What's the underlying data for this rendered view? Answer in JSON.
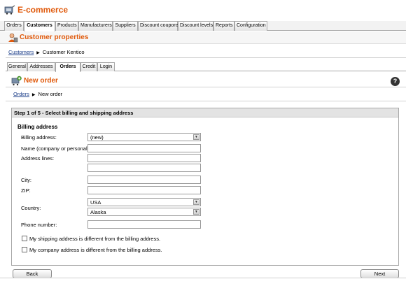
{
  "app": {
    "title": "E-commerce",
    "icon": "ecommerce-icon"
  },
  "main_tabs": [
    "Orders",
    "Customers",
    "Products",
    "Manufacturers",
    "Suppliers",
    "Discount coupons",
    "Discount levels",
    "Reports",
    "Configuration"
  ],
  "main_tab_active": "Customers",
  "section": {
    "title": "Customer properties",
    "icon": "customer-icon"
  },
  "breadcrumb1": {
    "link": "Customers",
    "current": "Customer Kentico"
  },
  "sub_tabs": [
    "General",
    "Addresses",
    "Orders",
    "Credit",
    "Login"
  ],
  "sub_tab_active": "Orders",
  "new_order": {
    "title": "New order",
    "icon": "new-order-icon"
  },
  "help": {
    "label": "?",
    "icon": "help-icon"
  },
  "breadcrumb2": {
    "link": "Orders",
    "current": "New order"
  },
  "wizard": {
    "step_title": "Step 1 of 5 - Select billing and shipping address",
    "section_title": "Billing address",
    "fields": {
      "billing_address_label": "Billing address:",
      "billing_address_value": "(new)",
      "name_label": "Name (company or personal):",
      "name_value": "",
      "address_lines_label": "Address lines:",
      "address_line1_value": "",
      "address_line2_value": "",
      "city_label": "City:",
      "city_value": "",
      "zip_label": "ZIP:",
      "zip_value": "",
      "country_label": "Country:",
      "country_value": "USA",
      "state_value": "Alaska",
      "phone_label": "Phone number:",
      "phone_value": ""
    },
    "checkbox_shipping": "My shipping address is different from the billing address.",
    "checkbox_company": "My company address is different from the billing address."
  },
  "buttons": {
    "back": "Back",
    "next": "Next"
  },
  "colors": {
    "accent": "#e05a0c",
    "link": "#1d3f8a",
    "header_bg": "#e3e3e3"
  }
}
